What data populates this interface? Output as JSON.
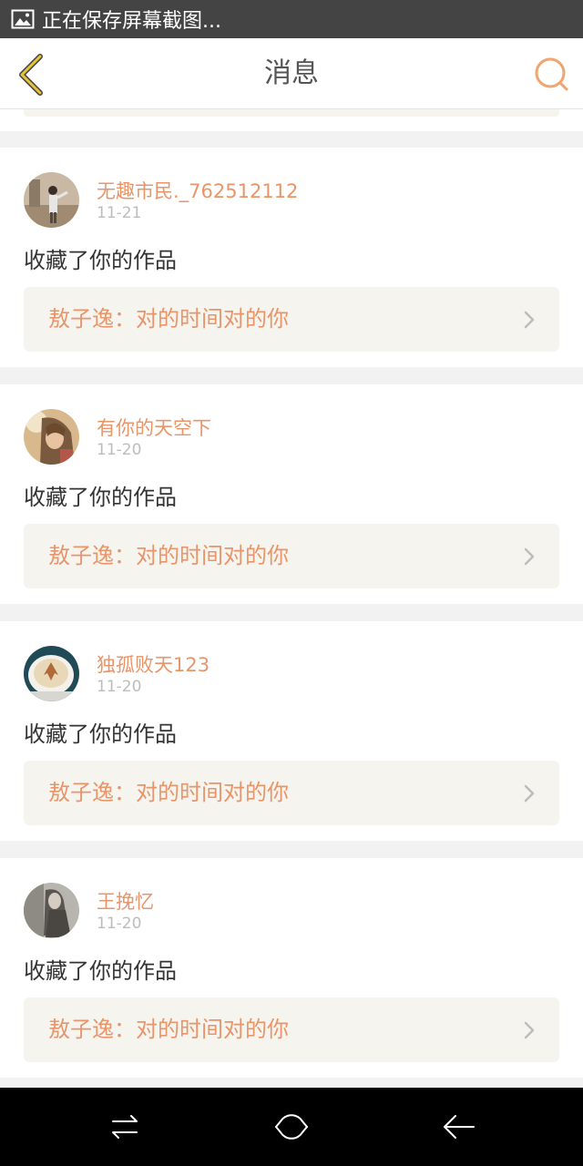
{
  "status_bar": {
    "text": "正在保存屏幕截图...",
    "icon": "image-icon"
  },
  "header": {
    "title": "消息",
    "back_icon": "chevron-left-icon",
    "search_icon": "search-icon",
    "accent_color": "#e8956a",
    "back_icon_color": "#e8c23c"
  },
  "messages": [
    {
      "username": "无趣市民._762512112",
      "date": "11-21",
      "action": "收藏了你的作品",
      "work_title": "敖子逸：对的时间对的你"
    },
    {
      "username": "有你的天空下",
      "date": "11-20",
      "action": "收藏了你的作品",
      "work_title": "敖子逸：对的时间对的你"
    },
    {
      "username": "独孤败天123",
      "date": "11-20",
      "action": "收藏了你的作品",
      "work_title": "敖子逸：对的时间对的你"
    },
    {
      "username": "王挽忆",
      "date": "11-20",
      "action": "收藏了你的作品",
      "work_title": "敖子逸：对的时间对的你"
    }
  ],
  "nav_bar": {
    "left_icon": "switch-apps-icon",
    "center_icon": "home-icon",
    "right_icon": "back-arrow-icon"
  }
}
